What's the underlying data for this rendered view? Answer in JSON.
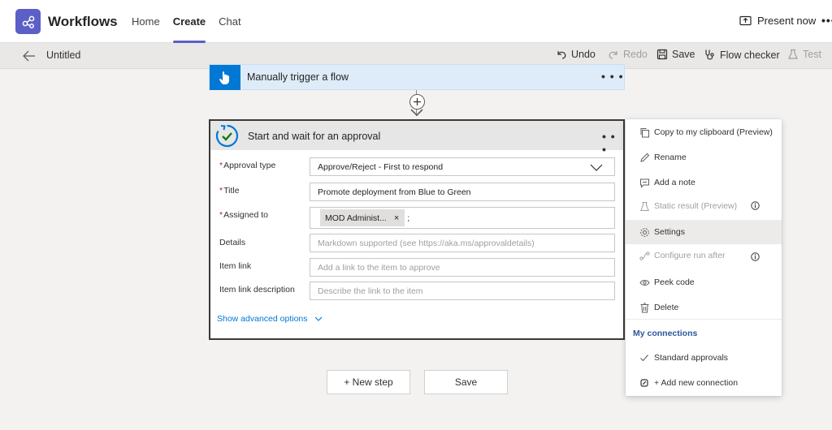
{
  "app": {
    "title": "Workflows",
    "accent": "#5b5fc7",
    "nav": [
      {
        "label": "Home",
        "active": false
      },
      {
        "label": "Create",
        "active": true
      },
      {
        "label": "Chat",
        "active": false
      }
    ],
    "present_label": "Present now",
    "more_label": "•••"
  },
  "command_bar": {
    "flow_name": "Untitled",
    "undo": "Undo",
    "redo": "Redo",
    "save": "Save",
    "flow_checker": "Flow checker",
    "test": "Test"
  },
  "trigger": {
    "title": "Manually trigger a flow",
    "more": "• • •"
  },
  "approval": {
    "title": "Start and wait for an approval",
    "more": "• • •",
    "fields": {
      "approval_type": {
        "label": "Approval type",
        "required": true,
        "value": "Approve/Reject - First to respond"
      },
      "title": {
        "label": "Title",
        "required": true,
        "value": "Promote deployment from Blue to Green"
      },
      "assigned_to": {
        "label": "Assigned to",
        "required": true,
        "chip": "MOD Administ...",
        "chip_remove": "×",
        "suffix": ";"
      },
      "details": {
        "label": "Details",
        "placeholder": "Markdown supported (see https://aka.ms/approvaldetails)"
      },
      "item_link": {
        "label": "Item link",
        "placeholder": "Add a link to the item to approve"
      },
      "item_link_description": {
        "label": "Item link description",
        "placeholder": "Describe the link to the item"
      }
    },
    "required_mark": "*",
    "show_advanced": "Show advanced options"
  },
  "buttons": {
    "new_step": "+ New step",
    "save": "Save"
  },
  "menu": {
    "items": [
      {
        "label": "Copy to my clipboard (Preview)",
        "icon": "copy-icon",
        "disabled": false
      },
      {
        "label": "Rename",
        "icon": "pencil-icon",
        "disabled": false
      },
      {
        "label": "Add a note",
        "icon": "note-icon",
        "disabled": false
      },
      {
        "label": "Static result (Preview)",
        "icon": "beaker-icon",
        "disabled": true
      },
      {
        "label": "Settings",
        "icon": "gear-icon",
        "disabled": false,
        "highlighted": true
      },
      {
        "label": "Configure run after",
        "icon": "run-after-icon",
        "disabled": true
      },
      {
        "label": "Peek code",
        "icon": "eye-icon",
        "disabled": false
      },
      {
        "label": "Delete",
        "icon": "trash-icon",
        "disabled": false
      }
    ],
    "section_title": "My connections",
    "connections": [
      {
        "label": "Standard approvals",
        "icon": "check-icon"
      },
      {
        "label": "+ Add new connection",
        "icon": "connection-icon"
      }
    ]
  }
}
